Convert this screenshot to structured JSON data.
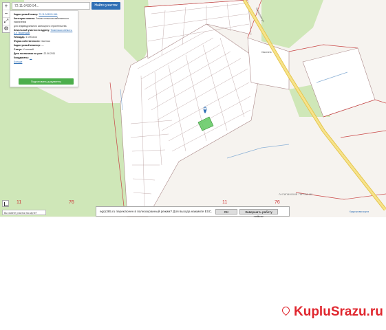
{
  "search": {
    "value": "72:11:0430 94...",
    "button_label": "Найти участок"
  },
  "zoom": {
    "in_label": "+",
    "out_label": "−",
    "fullscreen_label": "⤢",
    "settings_label": "⚙"
  },
  "info_panel": {
    "cadastral_number_label": "Кадастровый номер:",
    "cadastral_number_value": "72:11:043001:346",
    "category_label": "Категория земель:",
    "category_value": "Земли сельскохозяйственного назначения",
    "use_value": "для индивидуального жилищного строительства",
    "address_label": "Земельный участок по адресу:",
    "address_value": "Тюменская область, р-н Тюменский",
    "area_label": "Площадь:",
    "area_value": "1 000 кв.м",
    "owner_label": "Форма собственности:",
    "owner_value": "Частная",
    "engineer_label": "Кадастровый инженер:",
    "engineer_value": "—",
    "status_label": "Статус:",
    "status_value": "Учтенный",
    "registration_label": "Дата постановки на учет:",
    "registration_value": "22.06.2011",
    "coords_label": "Координаты:",
    "coords_value": "—",
    "more_link": "Больше",
    "button_label": "Подготовить документы"
  },
  "map_labels": {
    "village": "Ожогина",
    "road": "Сибирская ул.",
    "area": "Антипинский Питомник"
  },
  "grid_numbers": [
    "11",
    "76",
    "11",
    "76"
  ],
  "question_label": "Вы знаете участки на карте?",
  "notice": {
    "message": "egrp365.ru переключен в полноэкранный режим? Для выхода нажмите ESC.",
    "ok_label": "OK",
    "end_label": "Завершить работу сейчас"
  },
  "attribution": "Кадастровая карта",
  "watermark": "KupluSrazu.ru",
  "colors": {
    "accent": "#2f6fb5",
    "button_green": "#4cae4c",
    "forest": "#cfe7b8",
    "road": "#f2d76b",
    "boundary": "#c94444",
    "watermark": "#e0262e"
  }
}
